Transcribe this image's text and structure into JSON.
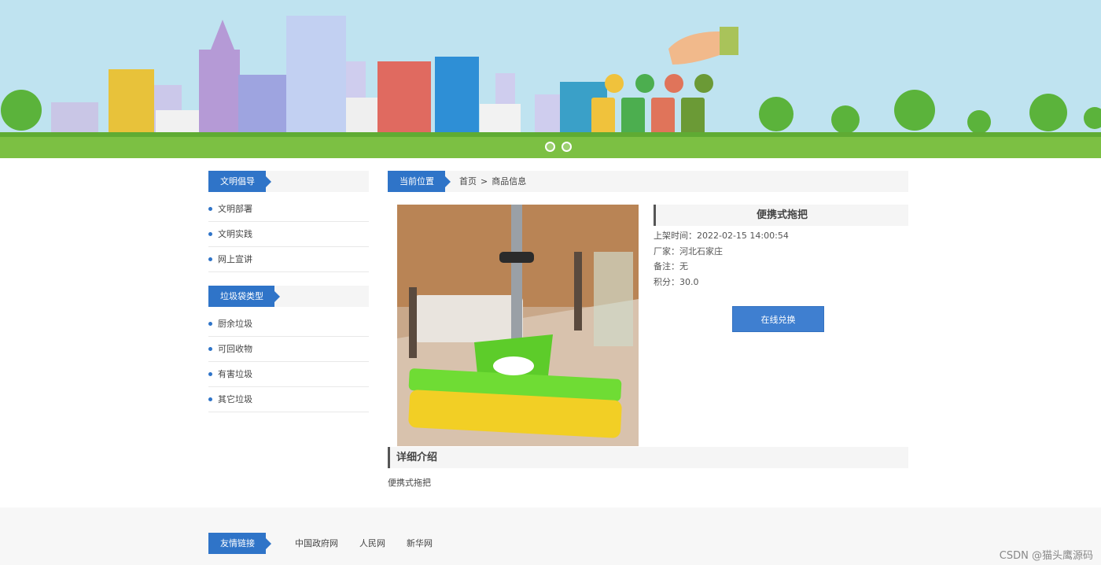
{
  "banner": {
    "slides": 2,
    "active_slide": 0
  },
  "sidebar": {
    "sections": [
      {
        "title": "文明倡导",
        "items": [
          "文明部署",
          "文明实践",
          "网上宣讲"
        ]
      },
      {
        "title": "垃圾袋类型",
        "items": [
          "厨余垃圾",
          "可回收物",
          "有害垃圾",
          "其它垃圾"
        ]
      }
    ]
  },
  "breadcrumb": {
    "label": "当前位置",
    "home": "首页",
    "separator": ">",
    "current": "商品信息"
  },
  "product": {
    "title": "便携式拖把",
    "listed_time": "上架时间：2022-02-15 14:00:54",
    "manufacturer": "厂家：河北石家庄",
    "remark": "备注：无",
    "points": "积分：30.0",
    "exchange_label": "在线兑换"
  },
  "detail": {
    "title": "详细介绍",
    "body": "便携式拖把"
  },
  "footer": {
    "label": "友情链接",
    "links": [
      "中国政府网",
      "人民网",
      "新华网"
    ],
    "watermark": "CSDN @猫头鹰源码"
  },
  "colors": {
    "accent": "#2f74c8",
    "button": "#3f7fd0",
    "sky": "#bfe3f0",
    "grass": "#7cc043"
  }
}
